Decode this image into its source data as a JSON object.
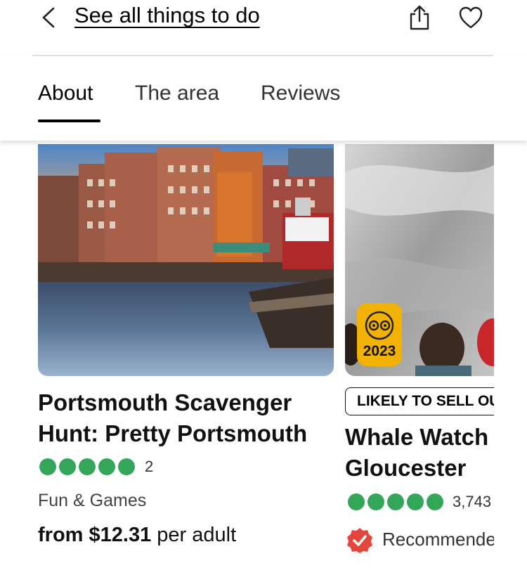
{
  "header": {
    "back_icon": "chevron-left-icon",
    "see_all_label": "See all things to do",
    "share_icon": "share-icon",
    "save_icon": "heart-icon"
  },
  "tabs": [
    {
      "label": "About",
      "active": true
    },
    {
      "label": "The area",
      "active": false
    },
    {
      "label": "Reviews",
      "active": false
    }
  ],
  "cards": [
    {
      "title_line1": "Portsmouth Scavenger",
      "title_line2": "Hunt: Pretty Portsmouth",
      "rating_bubbles": 5,
      "review_count": "2",
      "category": "Fun & Games",
      "price_prefix": "from",
      "price": "$12.31",
      "price_suffix": "per adult"
    },
    {
      "badge_year": "2023",
      "tag": "LIKELY TO SELL OUT",
      "title_line1": "Whale Watch",
      "title_line2": "Gloucester",
      "rating_bubbles": 5,
      "review_count": "3,743",
      "recommend_label": "Recommended"
    }
  ],
  "colors": {
    "rating_green": "#34a65a",
    "badge_yellow": "#f2b203",
    "recommend_red": "#e4463c"
  }
}
